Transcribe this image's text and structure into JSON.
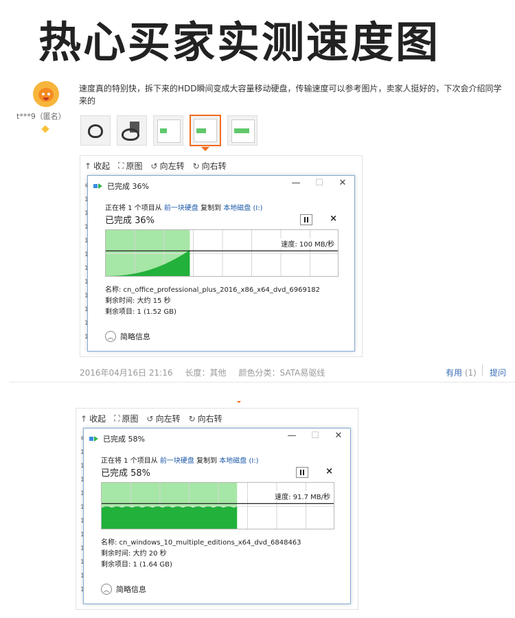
{
  "headline": "热心买家实测速度图",
  "reviewer": {
    "name": "t***9（匿名）"
  },
  "review_text": "速度真的特别快，拆下来的HDD瞬间变成大容量移动硬盘，传输速度可以参考图片，卖家人挺好的，下次会介绍同学来的",
  "thumbnails": [
    "cable-photo",
    "drive-photo",
    "copy-dialog-screenshot",
    "copy-dialog-screenshot",
    "copy-dialog-screenshot"
  ],
  "selected_thumbnail": 4,
  "viewer_toolbar": {
    "collapse": "收起",
    "original": "原图",
    "rotate_left": "向左转",
    "rotate_right": "向右转"
  },
  "side_strip": [
    "※",
    "1",
    "1",
    "1",
    "1",
    "1",
    "1",
    "1",
    "1",
    "1",
    "1",
    "1"
  ],
  "dialog1": {
    "title": "已完成 36%",
    "line_prefix": "正在将 1 个项目从 ",
    "source": "前一块硬盘",
    "line_mid": " 复制到 ",
    "destination": "本地磁盘 (I:)",
    "percent_text": "已完成 36%",
    "progress": 0.36,
    "speed": "速度: 100 MB/秒",
    "name_line": "名称: cn_office_professional_plus_2016_x86_x64_dvd_6969182",
    "time_line": "剩余时间: 大约 15 秒",
    "items_line": "剩余项目: 1 (1.52 GB)",
    "details": "简略信息"
  },
  "dialog2": {
    "title": "已完成 58%",
    "line_prefix": "正在将 1 个项目从 ",
    "source": "前一块硬盘",
    "line_mid": " 复制到 ",
    "destination": "本地磁盘 (I:)",
    "percent_text": "已完成 58%",
    "progress": 0.58,
    "speed": "速度: 91.7 MB/秒",
    "name_line": "名称: cn_windows_10_multiple_editions_x64_dvd_6848463",
    "time_line": "剩余时间: 大约 20 秒",
    "items_line": "剩余项目: 1 (1.64 GB)",
    "details": "简略信息"
  },
  "meta": {
    "date": "2016年04月16日 21:16",
    "length": "长度：其他",
    "color": "颜色分类：SATA易驱线"
  },
  "actions": {
    "helpful": "有用",
    "helpful_count": "(1)",
    "ask": "提问"
  },
  "colors": {
    "accent": "#f26b1d",
    "link": "#3a6eb5",
    "graph_green": "#22b13a",
    "graph_light": "#a6e6a6"
  }
}
